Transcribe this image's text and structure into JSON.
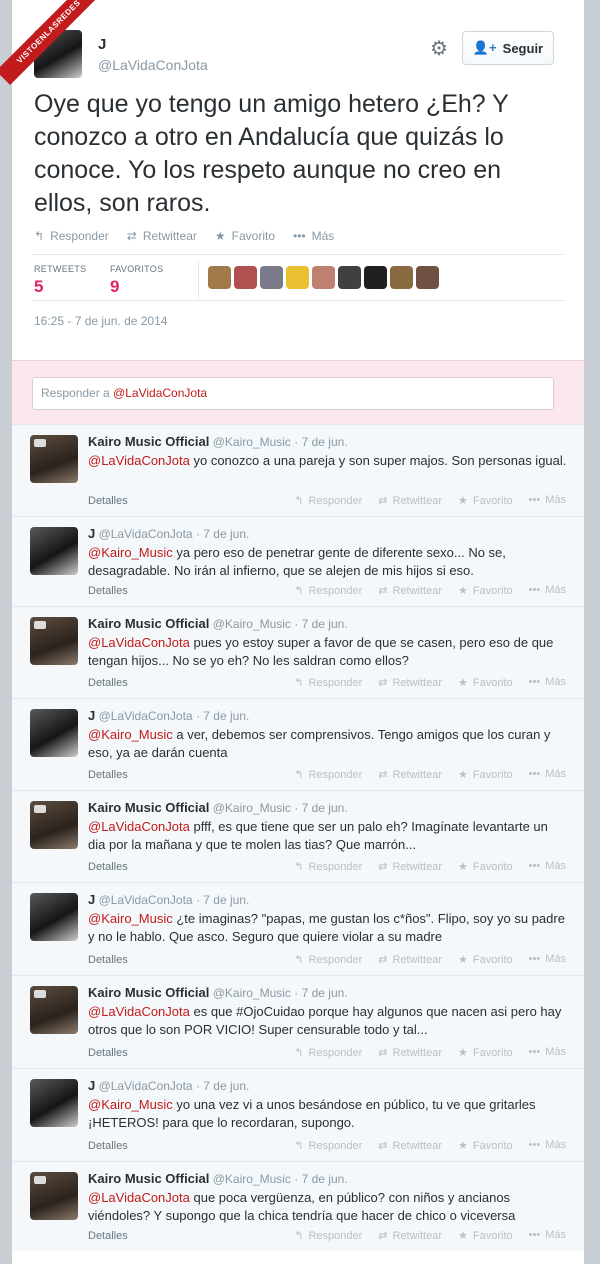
{
  "watermark": "VISTOENLASREDES",
  "tweet": {
    "author_name": "J",
    "author_handle": "@LaVidaConJota",
    "follow_label": "Seguir",
    "text": "Oye que yo tengo un amigo hetero ¿Eh? Y conozco a otro en Andalucía que quizás lo conoce. Yo los respeto aunque no creo en ellos, son raros.",
    "actions": {
      "reply": "Responder",
      "retweet": "Retwittear",
      "favorite": "Favorito",
      "more": "Más"
    },
    "stats": {
      "retweets_label": "RETWEETS",
      "retweets_count": "5",
      "favorites_label": "FAVORITOS",
      "favorites_count": "9"
    },
    "timestamp": "16:25 - 7 de jun. de 2014"
  },
  "reply_box": {
    "prefix": "Responder a ",
    "mention": "@LaVidaConJota"
  },
  "icons": {
    "gear": "gear-icon",
    "follow": "person-add-icon",
    "reply": "reply-arrow-icon",
    "retweet": "retweet-icon",
    "favorite": "star-icon",
    "more": "ellipsis-icon"
  },
  "colors": {
    "mention": "#c11b1b",
    "stats_number": "#e0245e",
    "ribbon": "#c11b1b"
  },
  "replies": [
    {
      "name": "Kairo Music Official",
      "handle": "@Kairo_Music",
      "date": "· 7 de jun.",
      "mention": "@LaVidaConJota",
      "text": " yo conozco a una pareja y son super majos. Son personas igual.",
      "details": "Detalles",
      "author": "k"
    },
    {
      "name": "J",
      "handle": "@LaVidaConJota",
      "date": "· 7 de jun.",
      "mention": "@Kairo_Music",
      "text": " ya pero eso de penetrar gente de diferente sexo... No se, desagradable. No irán al infierno, que se alejen de mis hijos si eso.",
      "details": "Detalles",
      "author": "j"
    },
    {
      "name": "Kairo Music Official",
      "handle": "@Kairo_Music",
      "date": "· 7 de jun.",
      "mention": "@LaVidaConJota",
      "text": " pues yo estoy super a favor de que se casen, pero eso de que tengan hijos... No se yo eh? No les saldran como ellos?",
      "details": "Detalles",
      "author": "k"
    },
    {
      "name": "J",
      "handle": "@LaVidaConJota",
      "date": "· 7 de jun.",
      "mention": "@Kairo_Music",
      "text": " a ver, debemos ser comprensivos. Tengo amigos que los curan y eso, ya ae darán cuenta",
      "details": "Detalles",
      "author": "j"
    },
    {
      "name": "Kairo Music Official",
      "handle": "@Kairo_Music",
      "date": "· 7 de jun.",
      "mention": "@LaVidaConJota",
      "text": " pfff, es que tiene que ser un palo eh? Imagínate levantarte un dia por la mañana y que te molen las tias? Que marrón...",
      "details": "Detalles",
      "author": "k"
    },
    {
      "name": "J",
      "handle": "@LaVidaConJota",
      "date": "· 7 de jun.",
      "mention": "@Kairo_Music",
      "text": " ¿te imaginas? \"papas, me gustan los c*ños\". Flipo, soy yo su padre y no le hablo. Que asco. Seguro que quiere violar a su madre",
      "details": "Detalles",
      "author": "j"
    },
    {
      "name": "Kairo Music Official",
      "handle": "@Kairo_Music",
      "date": "· 7 de jun.",
      "mention": "@LaVidaConJota",
      "text": " es que #OjoCuidao porque hay algunos que nacen asi pero hay otros que lo son POR VICIO! Super censurable todo y tal...",
      "details": "Detalles",
      "author": "k"
    },
    {
      "name": "J",
      "handle": "@LaVidaConJota",
      "date": "· 7 de jun.",
      "mention": "@Kairo_Music",
      "text": " yo una vez vi a unos besándose en público, tu ve que gritarles ¡HETEROS! para que lo recordaran, supongo.",
      "details": "Detalles",
      "author": "j"
    },
    {
      "name": "Kairo Music Official",
      "handle": "@Kairo_Music",
      "date": "· 7 de jun.",
      "mention": "@LaVidaConJota",
      "text": " que poca vergüenza, en público? con niños y ancianos viéndoles? Y supongo que la chica tendría que hacer de chico o viceversa",
      "details": "Detalles",
      "author": "k"
    }
  ]
}
